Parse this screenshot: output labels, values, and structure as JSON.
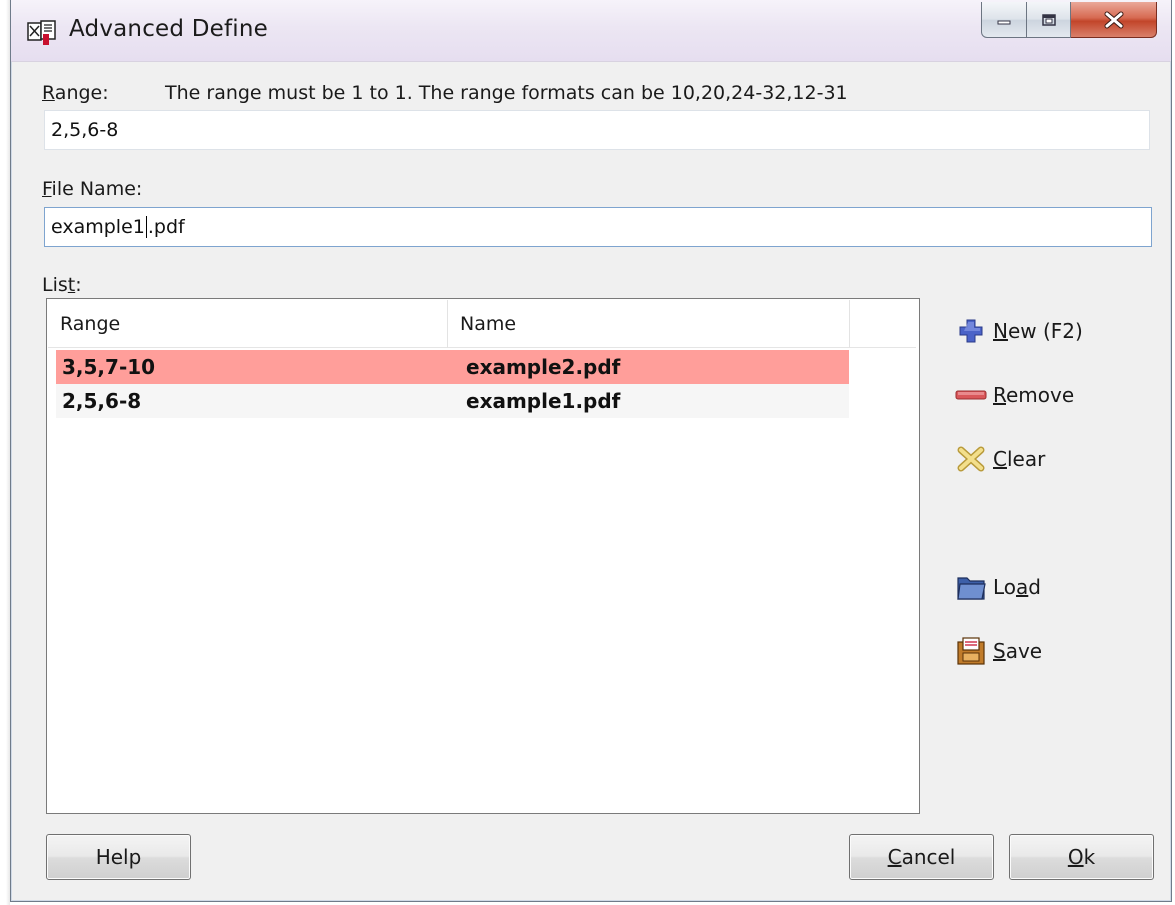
{
  "window": {
    "title": "Advanced Define"
  },
  "range": {
    "label_prefix": "R",
    "label_rest": "ange:",
    "hint": "The range must be 1 to 1. The range formats can be 10,20,24-32,12-31",
    "value": "2,5,6-8"
  },
  "file_name": {
    "label_prefix": "F",
    "label_rest": "ile Name:",
    "value_before_caret": "example1",
    "value_after_caret": ".pdf"
  },
  "list": {
    "label_before": "Lis",
    "label_underlined": "t",
    "label_after": ":",
    "columns": [
      "Range",
      "Name"
    ],
    "rows": [
      {
        "range": "3,5,7-10",
        "name": "example2.pdf",
        "selected": true
      },
      {
        "range": "2,5,6-8",
        "name": "example1.pdf",
        "selected": false
      }
    ]
  },
  "side_buttons": {
    "new": {
      "u": "N",
      "rest": "ew (F2)"
    },
    "remove": {
      "u": "R",
      "rest": "emove"
    },
    "clear": {
      "u": "C",
      "rest": "lear"
    },
    "load": {
      "pre": "Lo",
      "u": "a",
      "rest": "d"
    },
    "save": {
      "u": "S",
      "rest": "ave"
    }
  },
  "footer": {
    "help": "Help",
    "cancel": {
      "u": "C",
      "rest": "ancel"
    },
    "ok": {
      "u": "O",
      "rest": "k"
    }
  },
  "colors": {
    "selected_row": "#ff9e9a",
    "row_alt": "#f6f6f6",
    "focus_border": "#7ea4cf"
  },
  "icons": {
    "app": "pdf-split-icon",
    "new": "plus-icon",
    "remove": "minus-icon",
    "clear": "clear-x-icon",
    "load": "folder-icon",
    "save": "save-icon"
  }
}
